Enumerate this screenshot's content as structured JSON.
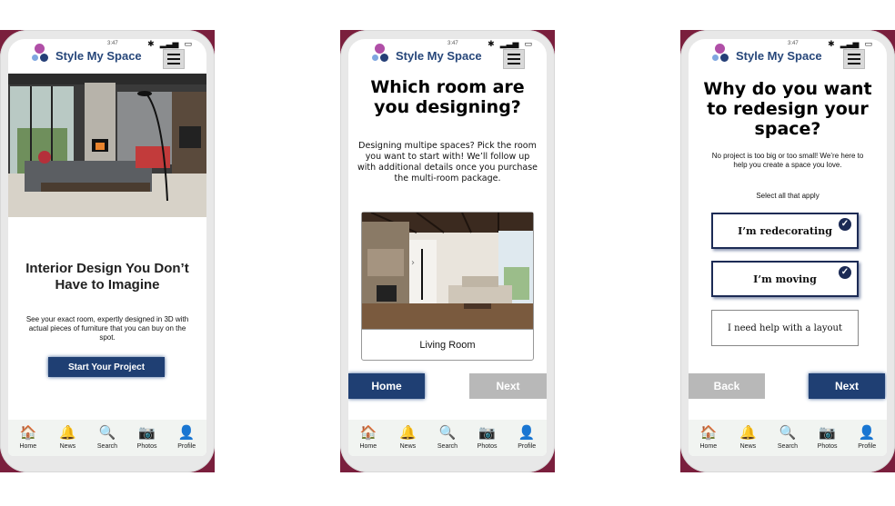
{
  "brand": "Style My Space",
  "status_time": "3:47",
  "nav": [
    {
      "label": "Home",
      "icon": "home-icon",
      "glyph": "🏠"
    },
    {
      "label": "News",
      "icon": "bell-icon",
      "glyph": "🔔"
    },
    {
      "label": "Search",
      "icon": "search-icon",
      "glyph": "🔍"
    },
    {
      "label": "Photos",
      "icon": "camera-icon",
      "glyph": "📷"
    },
    {
      "label": "Profile",
      "icon": "user-icon",
      "glyph": "👤"
    }
  ],
  "screen1": {
    "title": "Interior Design You Don’t Have to Imagine",
    "body": "See your exact room, expertly designed in 3D with actual pieces of furniture that you can buy on the spot.",
    "cta": "Start Your Project"
  },
  "screen2": {
    "title": "Which room are you designing?",
    "body": "Designing multipe spaces? Pick the room you want to start with! We’ll follow up with additional details once you purchase the multi-room package.",
    "room_label": "Living Room",
    "home": "Home",
    "next": "Next"
  },
  "screen3": {
    "title": "Why do you want to redesign your space?",
    "body": "No project is too big or too small! We’re here to help you create a space you love.",
    "hint": "Select all that apply",
    "options": [
      {
        "label": "I’m redecorating",
        "selected": true
      },
      {
        "label": "I’m moving",
        "selected": true
      },
      {
        "label": "I need help with a layout",
        "selected": false
      }
    ],
    "back": "Back",
    "next": "Next"
  },
  "colors": {
    "accent": "#1f3f73",
    "brand": "#27477a",
    "backdrop": "#7a1f3d",
    "disabled": "#b8b8b8"
  }
}
